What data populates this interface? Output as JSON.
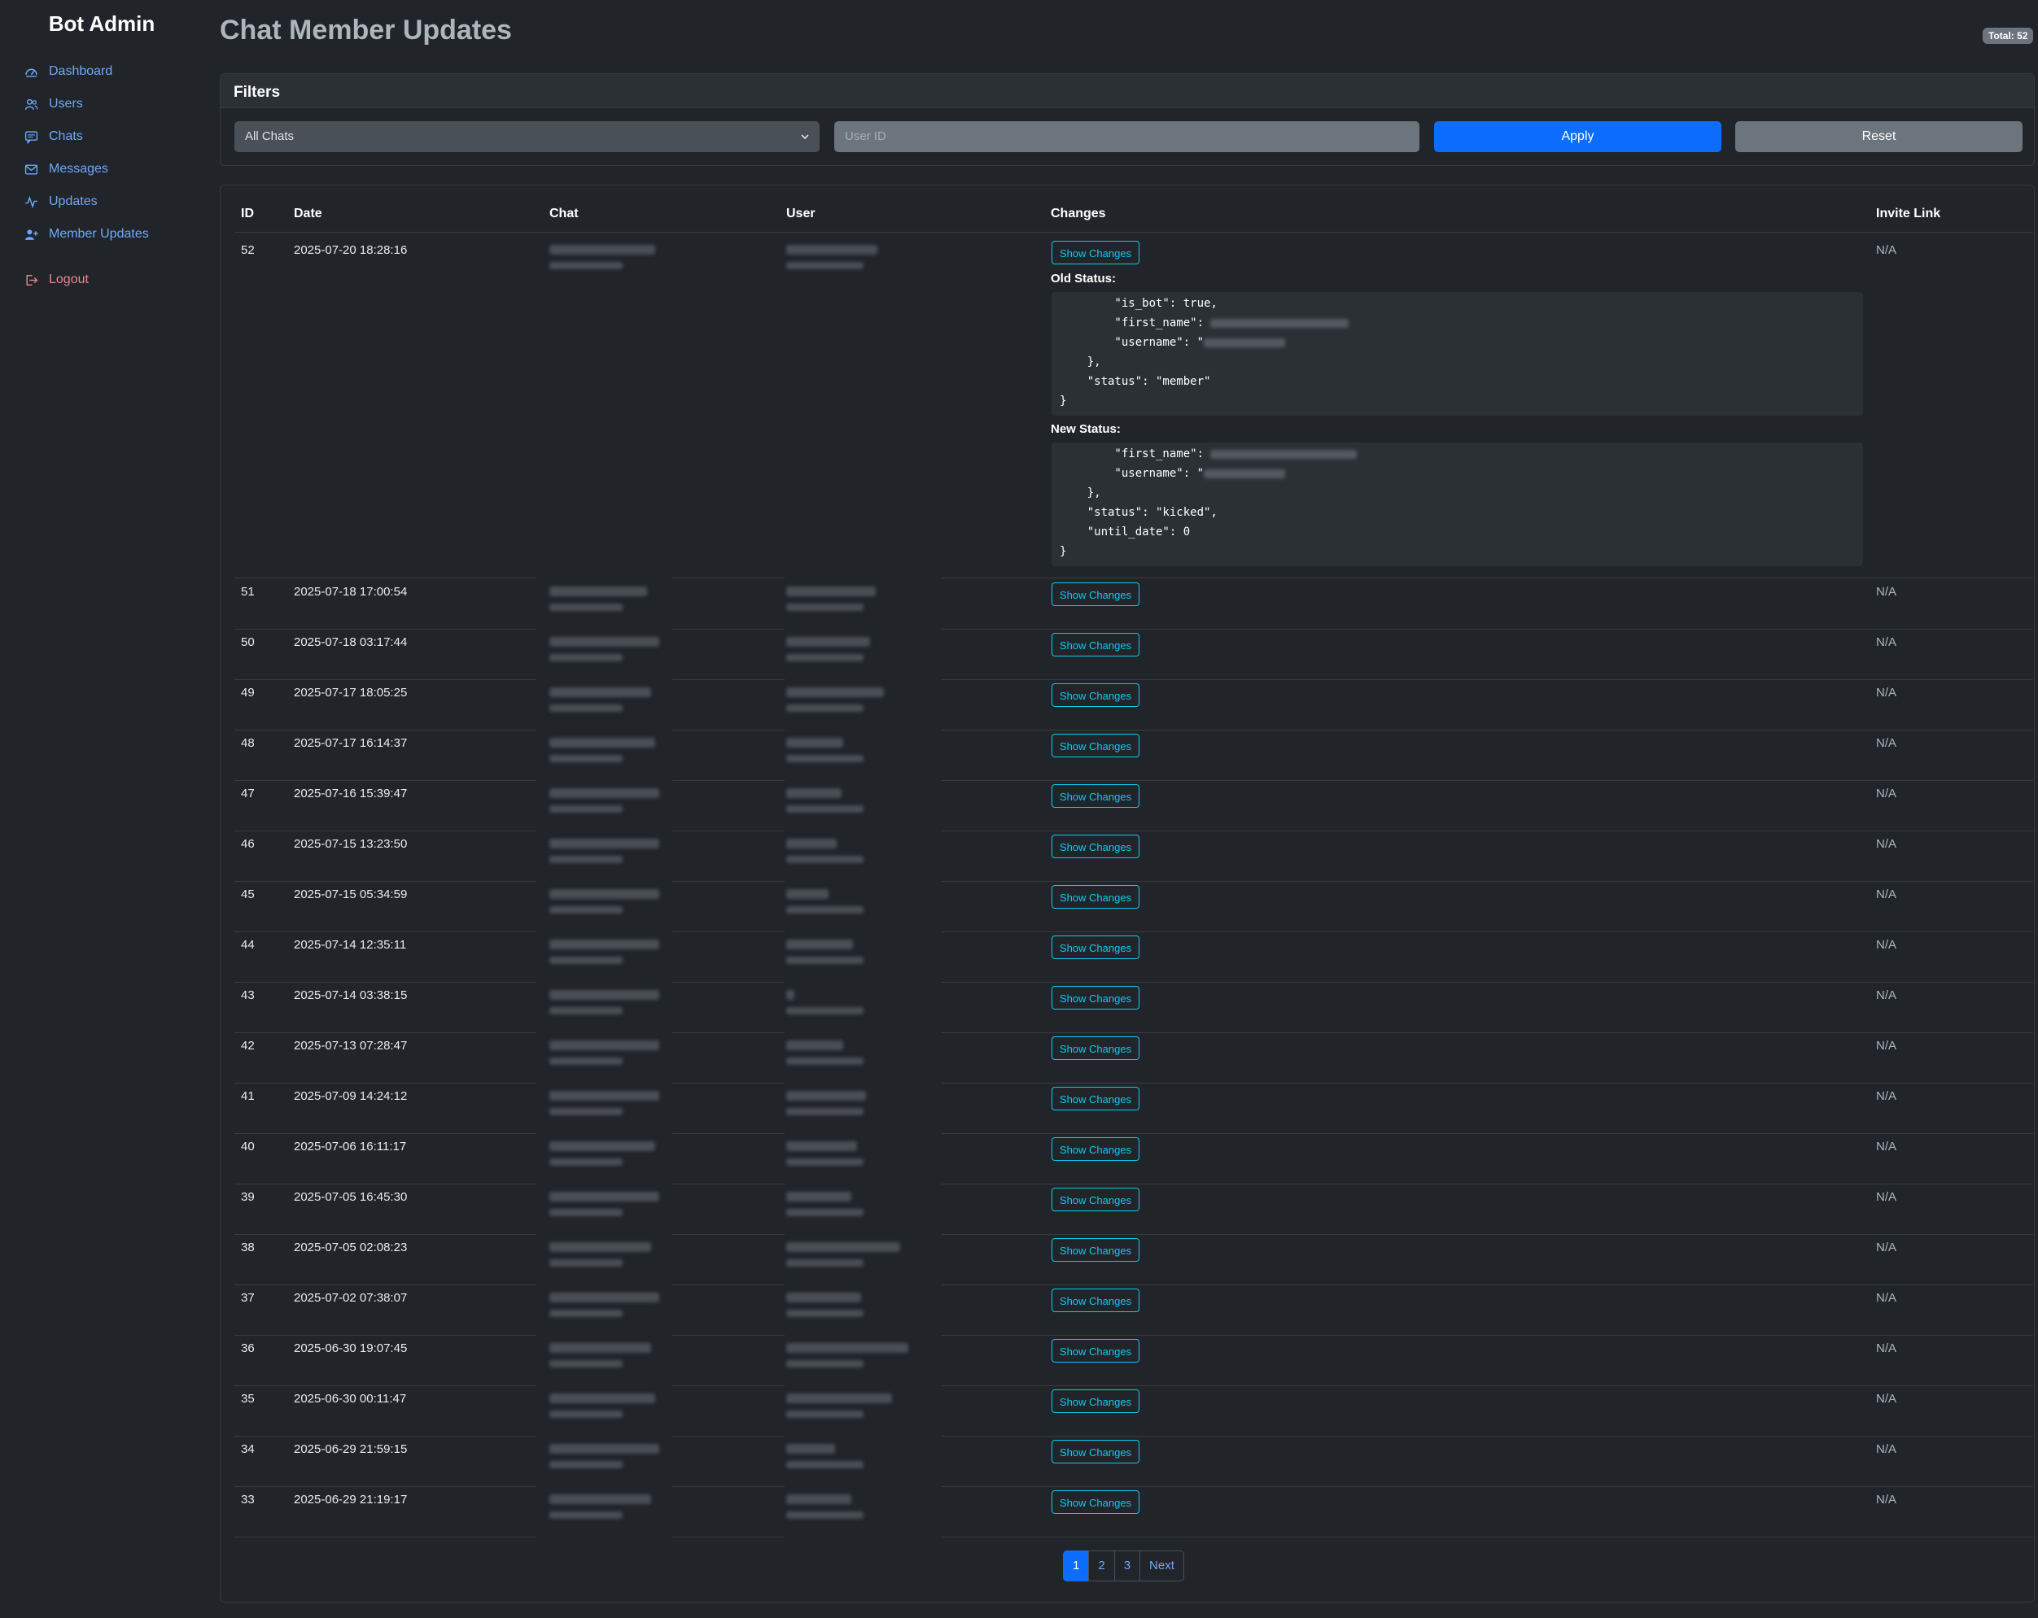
{
  "sidebar": {
    "brand": "Bot Admin",
    "items": [
      {
        "label": "Dashboard",
        "icon": "dashboard-icon"
      },
      {
        "label": "Users",
        "icon": "users-icon"
      },
      {
        "label": "Chats",
        "icon": "chat-icon"
      },
      {
        "label": "Messages",
        "icon": "envelope-icon"
      },
      {
        "label": "Updates",
        "icon": "activity-icon"
      },
      {
        "label": "Member Updates",
        "icon": "user-plus-icon"
      }
    ],
    "logout": {
      "label": "Logout",
      "icon": "logout-icon"
    }
  },
  "header": {
    "title": "Chat Member Updates",
    "total_badge": "Total: 52"
  },
  "filters": {
    "title": "Filters",
    "chat_select_value": "All Chats",
    "user_id_placeholder": "User ID",
    "apply_label": "Apply",
    "reset_label": "Reset"
  },
  "table": {
    "columns": [
      "ID",
      "Date",
      "Chat",
      "User",
      "Changes",
      "Invite Link"
    ],
    "show_changes_label": "Show Changes",
    "rows": [
      {
        "id": "52",
        "date": "2025-07-20 18:28:16",
        "invite_link": "N/A",
        "expanded": true
      },
      {
        "id": "51",
        "date": "2025-07-18 17:00:54",
        "invite_link": "N/A"
      },
      {
        "id": "50",
        "date": "2025-07-18 03:17:44",
        "invite_link": "N/A"
      },
      {
        "id": "49",
        "date": "2025-07-17 18:05:25",
        "invite_link": "N/A"
      },
      {
        "id": "48",
        "date": "2025-07-17 16:14:37",
        "invite_link": "N/A"
      },
      {
        "id": "47",
        "date": "2025-07-16 15:39:47",
        "invite_link": "N/A"
      },
      {
        "id": "46",
        "date": "2025-07-15 13:23:50",
        "invite_link": "N/A"
      },
      {
        "id": "45",
        "date": "2025-07-15 05:34:59",
        "invite_link": "N/A"
      },
      {
        "id": "44",
        "date": "2025-07-14 12:35:11",
        "invite_link": "N/A"
      },
      {
        "id": "43",
        "date": "2025-07-14 03:38:15",
        "invite_link": "N/A"
      },
      {
        "id": "42",
        "date": "2025-07-13 07:28:47",
        "invite_link": "N/A"
      },
      {
        "id": "41",
        "date": "2025-07-09 14:24:12",
        "invite_link": "N/A"
      },
      {
        "id": "40",
        "date": "2025-07-06 16:11:17",
        "invite_link": "N/A"
      },
      {
        "id": "39",
        "date": "2025-07-05 16:45:30",
        "invite_link": "N/A"
      },
      {
        "id": "38",
        "date": "2025-07-05 02:08:23",
        "invite_link": "N/A"
      },
      {
        "id": "37",
        "date": "2025-07-02 07:38:07",
        "invite_link": "N/A"
      },
      {
        "id": "36",
        "date": "2025-06-30 19:07:45",
        "invite_link": "N/A"
      },
      {
        "id": "35",
        "date": "2025-06-30 00:11:47",
        "invite_link": "N/A"
      },
      {
        "id": "34",
        "date": "2025-06-29 21:59:15",
        "invite_link": "N/A"
      },
      {
        "id": "33",
        "date": "2025-06-29 21:19:17",
        "invite_link": "N/A"
      }
    ]
  },
  "expanded_changes": {
    "old_label": "Old Status:",
    "new_label": "New Status:",
    "old_lines": [
      "        \"is_bot\": true,",
      "        \"first_name\": ",
      "        \"username\": \"",
      "    },",
      "    \"status\": \"member\"",
      "}"
    ],
    "new_lines": [
      "        \"first_name\": ",
      "        \"username\": \"",
      "    },",
      "    \"status\": \"kicked\",",
      "    \"until_date\": 0",
      "}"
    ]
  },
  "pagination": {
    "pages": [
      "1",
      "2",
      "3"
    ],
    "next": "Next",
    "current": "1"
  }
}
